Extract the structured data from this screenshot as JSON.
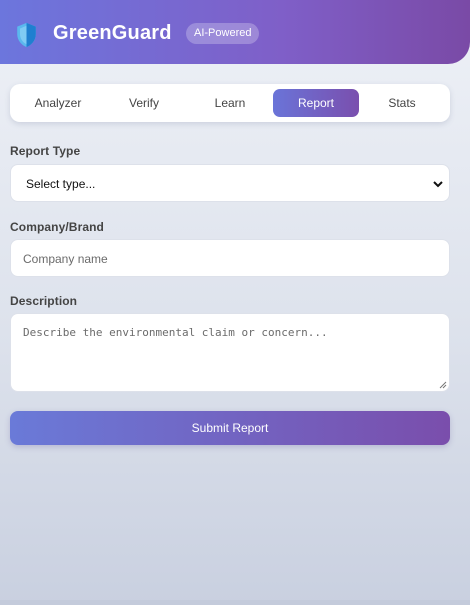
{
  "header": {
    "brand": "GreenGuard",
    "badge": "AI-Powered",
    "logo_icon": "shield-icon"
  },
  "tabs": [
    {
      "label": "Analyzer",
      "active": false
    },
    {
      "label": "Verify",
      "active": false
    },
    {
      "label": "Learn",
      "active": false
    },
    {
      "label": "Report",
      "active": true
    },
    {
      "label": "Stats",
      "active": false
    }
  ],
  "form": {
    "report_type": {
      "label": "Report Type",
      "selected": "Select type..."
    },
    "company": {
      "label": "Company/Brand",
      "placeholder": "Company name"
    },
    "description": {
      "label": "Description",
      "placeholder": "Describe the environmental claim or concern..."
    },
    "submit_label": "Submit Report"
  },
  "colors": {
    "accent_start": "#6a74d8",
    "accent_end": "#7a4fae",
    "shield": "#2f9be6"
  }
}
